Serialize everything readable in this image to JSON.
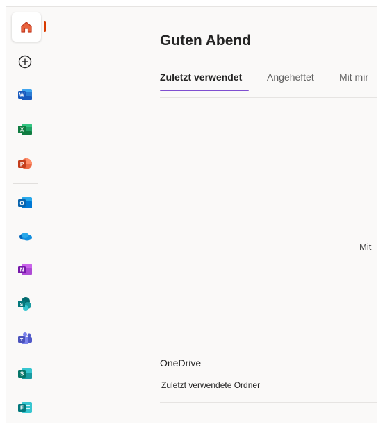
{
  "greeting": "Guten Abend",
  "tabs": [
    {
      "label": "Zuletzt verwendet",
      "active": true
    },
    {
      "label": "Angeheftet",
      "active": false
    },
    {
      "label": "Mit mir"
    }
  ],
  "empty_state_text": "Mit",
  "onedrive_section": {
    "title": "OneDrive",
    "subtitle": "Zuletzt verwendete Ordner"
  },
  "rail_icons": [
    "home-icon",
    "create-new-icon",
    "word-icon",
    "excel-icon",
    "powerpoint-icon",
    "outlook-icon",
    "onedrive-icon",
    "onenote-icon",
    "sharepoint-icon",
    "teams-icon",
    "sway-icon",
    "forms-icon"
  ],
  "colors": {
    "accent_underline": "#7f4fd0",
    "home_indicator": "#d83b01",
    "background": "#faf9f8"
  }
}
